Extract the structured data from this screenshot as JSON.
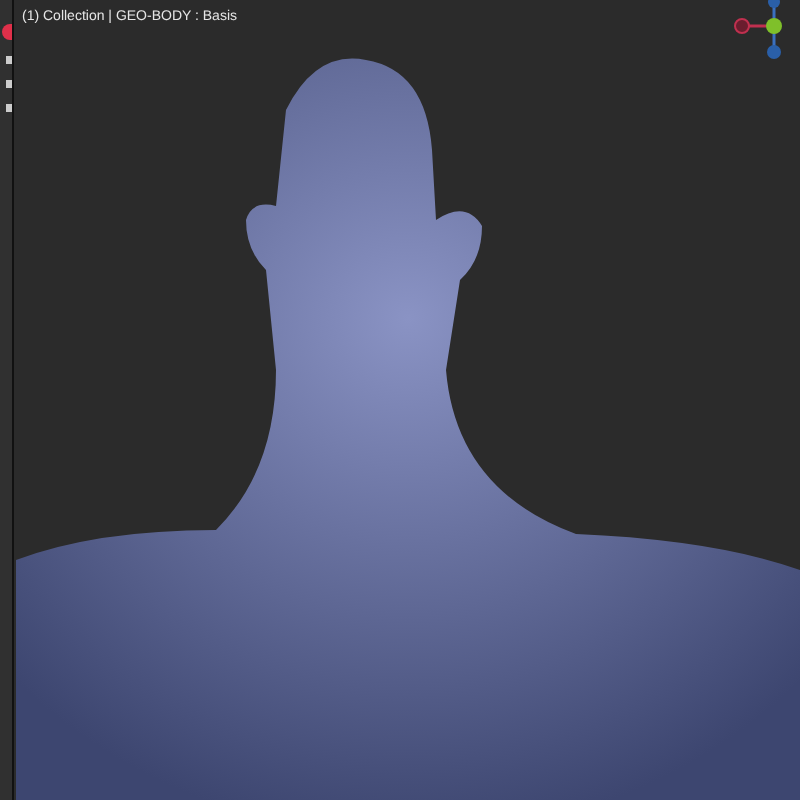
{
  "viewport": {
    "info_text": "(1) Collection | GEO-BODY : Basis"
  }
}
